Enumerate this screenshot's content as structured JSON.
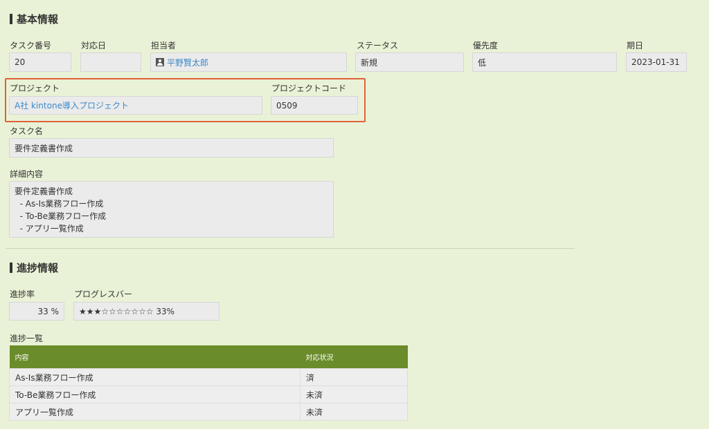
{
  "basic": {
    "section_title": "基本情報",
    "task_number": {
      "label": "タスク番号",
      "value": "20"
    },
    "response_date": {
      "label": "対応日",
      "value": ""
    },
    "assignee": {
      "label": "担当者",
      "value": "平野賢太郎"
    },
    "status": {
      "label": "ステータス",
      "value": "新規"
    },
    "priority": {
      "label": "優先度",
      "value": "低"
    },
    "due_date": {
      "label": "期日",
      "value": "2023-01-31"
    },
    "project": {
      "label": "プロジェクト",
      "value": "A社 kintone導入プロジェクト"
    },
    "project_code": {
      "label": "プロジェクトコード",
      "value": "0509"
    },
    "task_name": {
      "label": "タスク名",
      "value": "要件定義書作成"
    },
    "details": {
      "label": "詳細内容",
      "value": "要件定義書作成\n  - As-Is業務フロー作成\n  - To-Be業務フロー作成\n  - アプリ一覧作成"
    }
  },
  "progress": {
    "section_title": "進捗情報",
    "rate": {
      "label": "進捗率",
      "value": "33 %"
    },
    "progress_bar": {
      "label": "プログレスバー",
      "value": "★★★☆☆☆☆☆☆☆ 33%",
      "fraction": 0.33
    },
    "list": {
      "label": "進捗一覧",
      "headers": [
        "内容",
        "対応状況"
      ],
      "rows": [
        [
          "As-Is業務フロー作成",
          "済"
        ],
        [
          "To-Be業務フロー作成",
          "未済"
        ],
        [
          "アプリ一覧作成",
          "未済"
        ]
      ]
    }
  },
  "colors": {
    "background": "#e9f2d6",
    "field_bg": "#ebebeb",
    "table_header": "#6a8c2a",
    "link": "#3b88c8",
    "highlight": "#e0603a"
  }
}
